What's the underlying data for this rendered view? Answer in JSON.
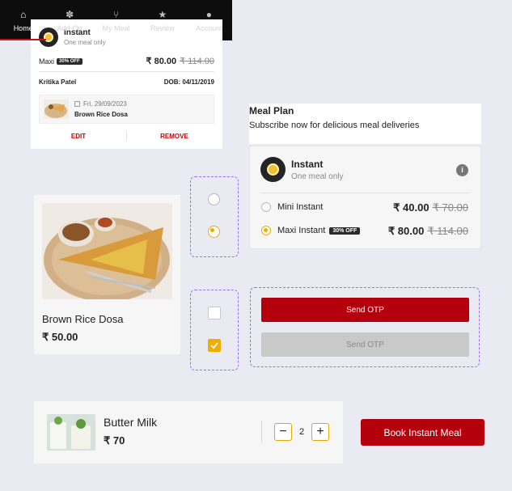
{
  "order_card": {
    "plan_title": "Instant",
    "plan_subtitle": "One meal only",
    "plan_name": "Maxi",
    "badge": "30% OFF",
    "price": "₹ 80.00",
    "old_price": "₹ 114.00",
    "customer_name": "Kritika Patel",
    "dob": "DOB: 04/11/2019",
    "meal_date": "Fri, 29/09/2023",
    "meal_name": "Brown Rice Dosa",
    "edit_label": "EDIT",
    "remove_label": "REMOVE"
  },
  "nav": {
    "items": [
      {
        "label": "Home",
        "icon": "home-icon",
        "glyph": "⌂",
        "active": true
      },
      {
        "label": "Add-On",
        "icon": "addon-icon",
        "glyph": "✽",
        "active": false
      },
      {
        "label": "My Meal",
        "icon": "cutlery-icon",
        "glyph": "⑂",
        "active": false
      },
      {
        "label": "Review",
        "icon": "star-icon",
        "glyph": "★",
        "active": false
      },
      {
        "label": "Account",
        "icon": "user-icon",
        "glyph": "●",
        "active": false
      }
    ]
  },
  "meal_plan": {
    "title": "Meal Plan",
    "subtitle": "Subscribe now for delicious meal deliveries",
    "card_title": "Instant",
    "card_subtitle": "One meal only",
    "info_icon": "i",
    "options": [
      {
        "label": "Mini Instant",
        "price": "₹ 40.00",
        "old_price": "₹ 70.00",
        "badge": "",
        "selected": false
      },
      {
        "label": "Maxi Instant",
        "price": "₹ 80.00",
        "old_price": "₹ 114.00",
        "badge": "30% OFF",
        "selected": true
      }
    ]
  },
  "food_card": {
    "name": "Brown Rice Dosa",
    "price": "₹ 50.00"
  },
  "otp_buttons": {
    "primary": "Send OTP",
    "disabled": "Send OTP"
  },
  "item": {
    "name": "Butter Milk",
    "price": "₹ 70",
    "quantity": "2",
    "minus": "−",
    "plus": "+"
  },
  "cta": {
    "label": "Book Instant Meal"
  },
  "colors": {
    "brand_red": "#b4000d",
    "accent_yellow": "#f0ad00",
    "nav_bg": "#0d0d0d"
  }
}
